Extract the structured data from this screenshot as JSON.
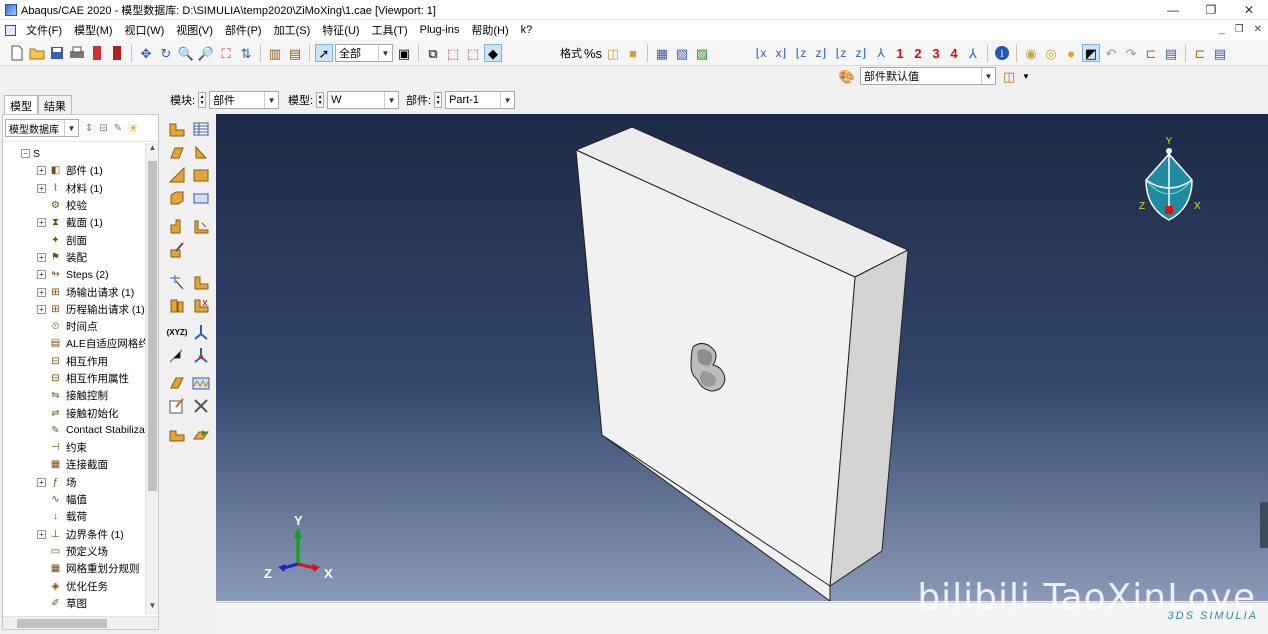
{
  "window": {
    "title": "Abaqus/CAE 2020 - 模型数据库: D:\\SIMULIA\\temp2020\\ZiMoXing\\1.cae [Viewport: 1]",
    "minimize": "—",
    "restore": "❐",
    "close": "✕"
  },
  "menu": {
    "items": [
      "文件(F)",
      "模型(M)",
      "视口(W)",
      "视图(V)",
      "部件(P)",
      "加工(S)",
      "特征(U)",
      "工具(T)",
      "Plug-ins",
      "帮助(H)",
      "k?"
    ]
  },
  "toolbar": {
    "selection_filter": "全部",
    "format_label": "格式",
    "viewport_nums": [
      "1",
      "2",
      "3",
      "4"
    ],
    "render_style": "部件默认值"
  },
  "left_tabs": {
    "model": "模型",
    "results": "结果"
  },
  "context": {
    "module_label": "模块:",
    "module_value": "部件",
    "model_label": "模型:",
    "model_value": "W",
    "part_label": "部件:",
    "part_value": "Part-1"
  },
  "tree": {
    "root_selector": "模型数据库",
    "items": [
      {
        "label": "S",
        "expander": "⊟",
        "icon": ""
      },
      {
        "label": "部件 (1)",
        "expander": "⊞",
        "icon": "part"
      },
      {
        "label": "材料 (1)",
        "expander": "⊞",
        "icon": "material"
      },
      {
        "label": "校验",
        "expander": "",
        "icon": "calibration"
      },
      {
        "label": "截面 (1)",
        "expander": "⊞",
        "icon": "section"
      },
      {
        "label": "剖面",
        "expander": "",
        "icon": "profile"
      },
      {
        "label": "装配",
        "expander": "⊞",
        "icon": "assembly"
      },
      {
        "label": "Steps (2)",
        "expander": "⊞",
        "icon": "steps"
      },
      {
        "label": "场输出请求 (1)",
        "expander": "⊞",
        "icon": "field-output"
      },
      {
        "label": "历程输出请求 (1)",
        "expander": "⊞",
        "icon": "history-output"
      },
      {
        "label": "时间点",
        "expander": "",
        "icon": "time-points"
      },
      {
        "label": "ALE自适应网格约束",
        "expander": "",
        "icon": "ale"
      },
      {
        "label": "相互作用",
        "expander": "",
        "icon": "interaction"
      },
      {
        "label": "相互作用属性",
        "expander": "",
        "icon": "interaction-property"
      },
      {
        "label": "接触控制",
        "expander": "",
        "icon": "contact-control"
      },
      {
        "label": "接触初始化",
        "expander": "",
        "icon": "contact-init"
      },
      {
        "label": "Contact Stabilizations",
        "expander": "",
        "icon": "contact-stab"
      },
      {
        "label": "约束",
        "expander": "",
        "icon": "constraint"
      },
      {
        "label": "连接截面",
        "expander": "",
        "icon": "connector-section"
      },
      {
        "label": "场",
        "expander": "⊞",
        "icon": "field"
      },
      {
        "label": "幅值",
        "expander": "",
        "icon": "amplitude"
      },
      {
        "label": "载荷",
        "expander": "",
        "icon": "load"
      },
      {
        "label": "边界条件 (1)",
        "expander": "⊞",
        "icon": "bc"
      },
      {
        "label": "预定义场",
        "expander": "",
        "icon": "predefined-field"
      },
      {
        "label": "网格重划分规则",
        "expander": "",
        "icon": "remesh"
      },
      {
        "label": "优化任务",
        "expander": "",
        "icon": "optimization"
      },
      {
        "label": "草图",
        "expander": "",
        "icon": "sketch"
      }
    ]
  },
  "triad": {
    "x": "X",
    "y": "Y",
    "z": "Z"
  },
  "view_cube": {
    "x": "X",
    "y": "Y",
    "z": "Z"
  },
  "watermark": "bilibili TaoXinLove",
  "brand": "3DS SIMULIA",
  "colors": {
    "viewport_top": "#1d2a47",
    "viewport_bottom": "#8a9ab8",
    "part_face": "#e8e8e8",
    "triad_x": "#d01919",
    "triad_y": "#11a011",
    "triad_z": "#2323c8"
  }
}
